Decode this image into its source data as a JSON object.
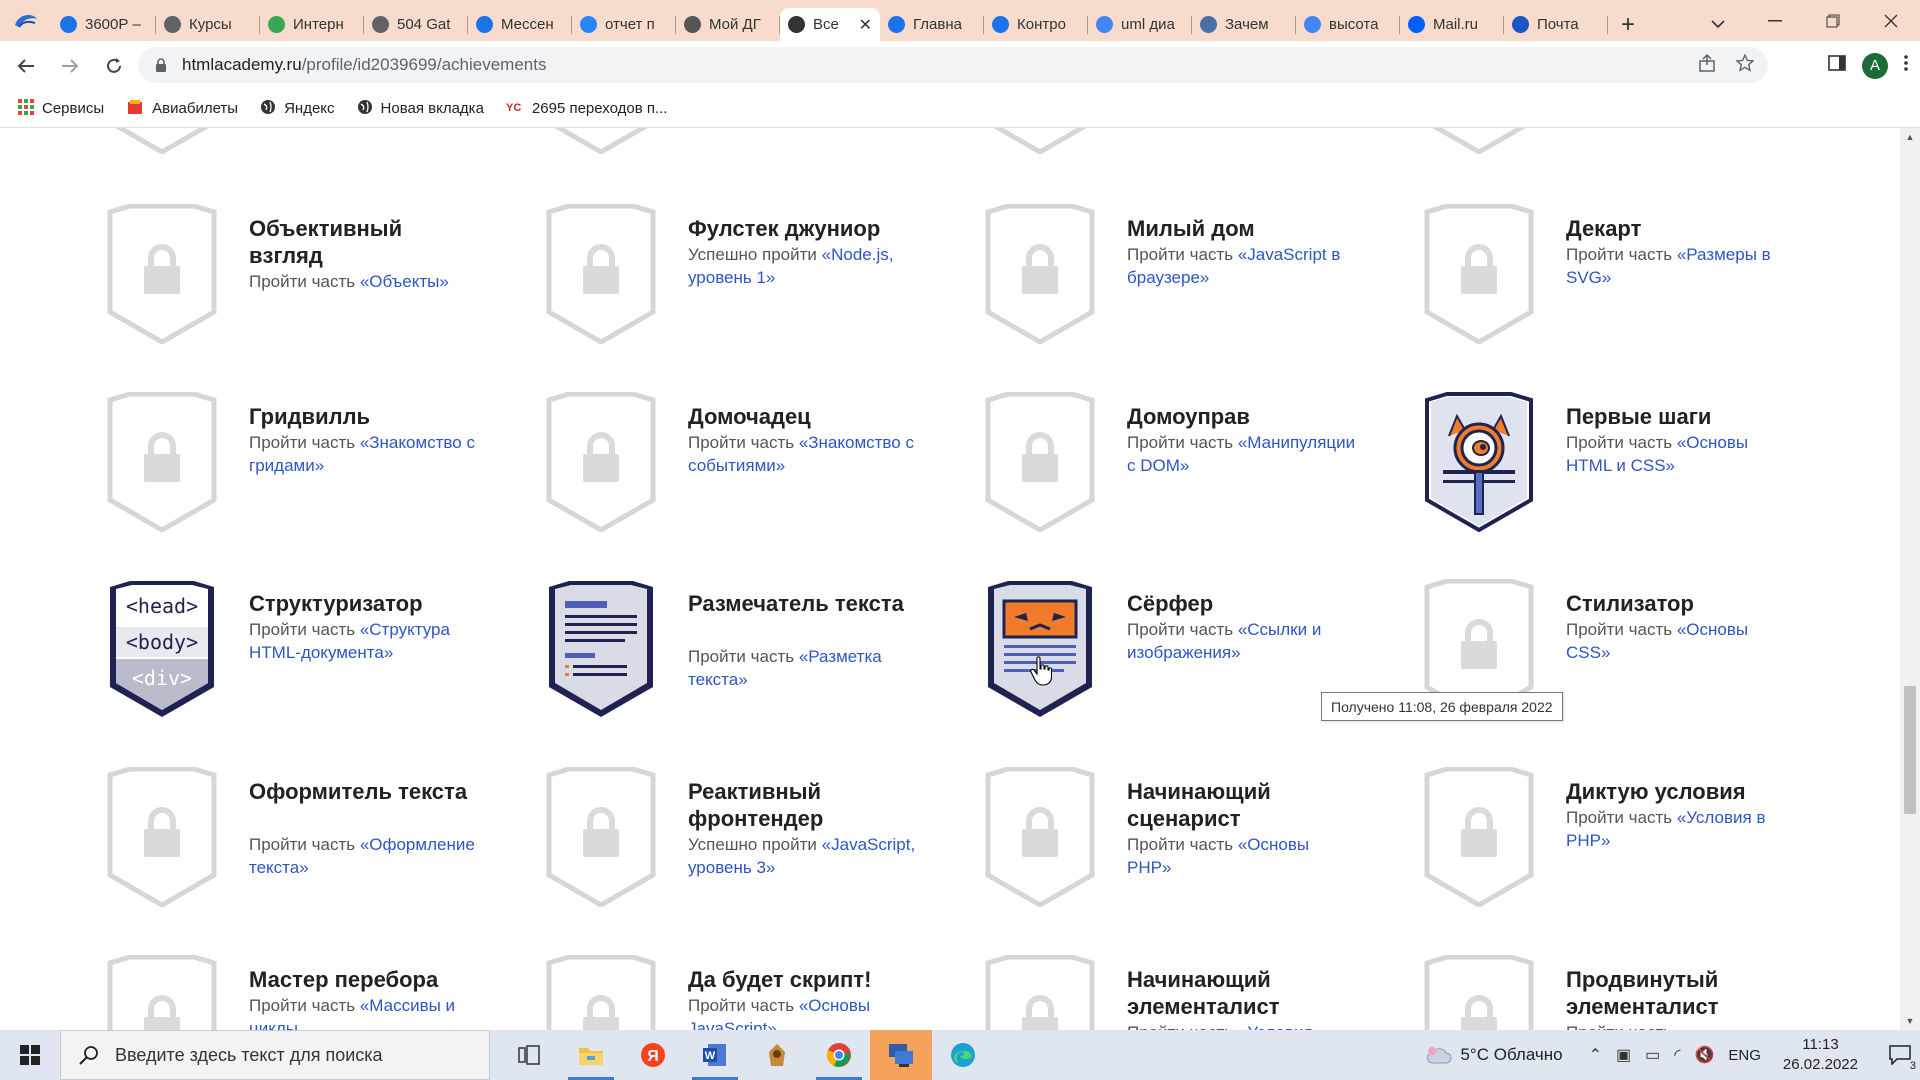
{
  "browser": {
    "tabs": [
      {
        "title": "3600Р –",
        "icon_color": "#1a73e8",
        "active": false
      },
      {
        "title": "Курсы",
        "icon_color": "#5f6368",
        "active": false
      },
      {
        "title": "Интерн",
        "icon_color": "#34a853",
        "active": false
      },
      {
        "title": "504 Gat",
        "icon_color": "#5f6368",
        "active": false
      },
      {
        "title": "Мессен",
        "icon_color": "#1a73e8",
        "active": false
      },
      {
        "title": "отчет п",
        "icon_color": "#2787f5",
        "active": false
      },
      {
        "title": "Мой ДГ",
        "icon_color": "#555555",
        "active": false
      },
      {
        "title": "Все",
        "icon_color": "#333333",
        "active": true
      },
      {
        "title": "Главна",
        "icon_color": "#1a73e8",
        "active": false
      },
      {
        "title": "Контро",
        "icon_color": "#1a73e8",
        "active": false
      },
      {
        "title": "uml диа",
        "icon_color": "#4285f4",
        "active": false
      },
      {
        "title": "Зачем",
        "icon_color": "#4a6fa5",
        "active": false
      },
      {
        "title": "высота",
        "icon_color": "#4285f4",
        "active": false
      },
      {
        "title": "Mail.ru",
        "icon_color": "#005ff9",
        "active": false
      },
      {
        "title": "Почта",
        "icon_color": "#1a56c4",
        "active": false
      }
    ],
    "address": {
      "host": "htmlacademy.ru",
      "path": "/profile/id2039699/achievements"
    },
    "avatar_letter": "A",
    "bookmarks": [
      {
        "label": "Сервисы",
        "icon": "apps-grid-icon"
      },
      {
        "label": "Авиабилеты",
        "icon": "plane-tickets-icon"
      },
      {
        "label": "Яндекс",
        "icon": "globe-icon"
      },
      {
        "label": "Новая вкладка",
        "icon": "globe-icon"
      },
      {
        "label": "2695 переходов п...",
        "icon": "counter-icon"
      }
    ]
  },
  "achievements": [
    {
      "name": "Объективный взгляд",
      "desc_prefix": "Пройти часть ",
      "desc_link": "«Объекты»",
      "earned": false
    },
    {
      "name": "Фулстек джуниор",
      "desc_prefix": "Успешно пройти ",
      "desc_link": "«Node.js, уровень 1»",
      "earned": false
    },
    {
      "name": "Милый дом",
      "desc_prefix": "Пройти часть ",
      "desc_link": "«JavaScript в браузере»",
      "earned": false
    },
    {
      "name": "Декарт",
      "desc_prefix": "Пройти часть ",
      "desc_link": "«Размеры в SVG»",
      "earned": false
    },
    {
      "name": "Гридвилль",
      "desc_prefix": "Пройти часть ",
      "desc_link": "«Знакомство с гридами»",
      "earned": false
    },
    {
      "name": "Домочадец",
      "desc_prefix": "Пройти часть ",
      "desc_link": "«Знакомство с событиями»",
      "earned": false
    },
    {
      "name": "Домоуправ",
      "desc_prefix": "Пройти часть ",
      "desc_link": "«Манипуляции с DOM»",
      "earned": false
    },
    {
      "name": "Первые шаги",
      "desc_prefix": "Пройти часть ",
      "desc_link": "«Основы HTML и CSS»",
      "earned": true,
      "art": "first-steps"
    },
    {
      "name": "Структуризатор",
      "desc_prefix": "Пройти часть ",
      "desc_link": "«Структура HTML-документа»",
      "earned": true,
      "art": "structurizer",
      "art_text": [
        "<head>",
        "<body>",
        "<div>"
      ]
    },
    {
      "name": "Размечатель текста",
      "desc_prefix": "Пройти часть ",
      "desc_link": "«Разметка текста»",
      "earned": true,
      "art": "text-markup"
    },
    {
      "name": "Сёрфер",
      "desc_prefix": "Пройти часть ",
      "desc_link": "«Ссылки и изображения»",
      "earned": true,
      "art": "surfer"
    },
    {
      "name": "Стилизатор",
      "desc_prefix": "Пройти часть ",
      "desc_link": "«Основы CSS»",
      "earned": false
    },
    {
      "name": "Оформитель текста",
      "desc_prefix": "Пройти часть ",
      "desc_link": "«Оформление текста»",
      "earned": false
    },
    {
      "name": "Реактивный фронтендер",
      "desc_prefix": "Успешно пройти ",
      "desc_link": "«JavaScript, уровень 3»",
      "earned": false
    },
    {
      "name": "Начинающий сценарист",
      "desc_prefix": "Пройти часть ",
      "desc_link": "«Основы PHP»",
      "earned": false
    },
    {
      "name": "Диктую условия",
      "desc_prefix": "Пройти часть ",
      "desc_link": "«Условия в PHP»",
      "earned": false
    },
    {
      "name": "Мастер перебора",
      "desc_prefix": "Пройти часть ",
      "desc_link": "«Массивы и циклы",
      "earned": false
    },
    {
      "name": "Да будет скрипт!",
      "desc_prefix": "Пройти часть ",
      "desc_link": "«Основы JavaScript»",
      "earned": false
    },
    {
      "name": "Начинающий элементалист",
      "desc_prefix": "Пройти часть ",
      "desc_link": "«Условия",
      "earned": false
    },
    {
      "name": "Продвинутый элементалист",
      "desc_prefix": "Пройти часть",
      "desc_link": "",
      "earned": false
    }
  ],
  "tooltip": "Получено 11:08, 26 февраля 2022",
  "colors": {
    "accent_link": "#2d56c4",
    "badge_locked": "#d4d4d4",
    "badge_navy": "#1f2352",
    "tab_strip": "#f7dccd"
  },
  "taskbar": {
    "search_placeholder": "Введите здесь текст для поиска",
    "apps": [
      "task-view-icon",
      "file-explorer-icon",
      "yandex-browser-icon",
      "word-icon",
      "game-icon",
      "chrome-icon",
      "remote-desktop-icon",
      "edge-icon"
    ],
    "weather": "5°C  Облачно",
    "lang": "ENG",
    "time": "11:13",
    "date": "26.02.2022",
    "notifications": "3"
  }
}
